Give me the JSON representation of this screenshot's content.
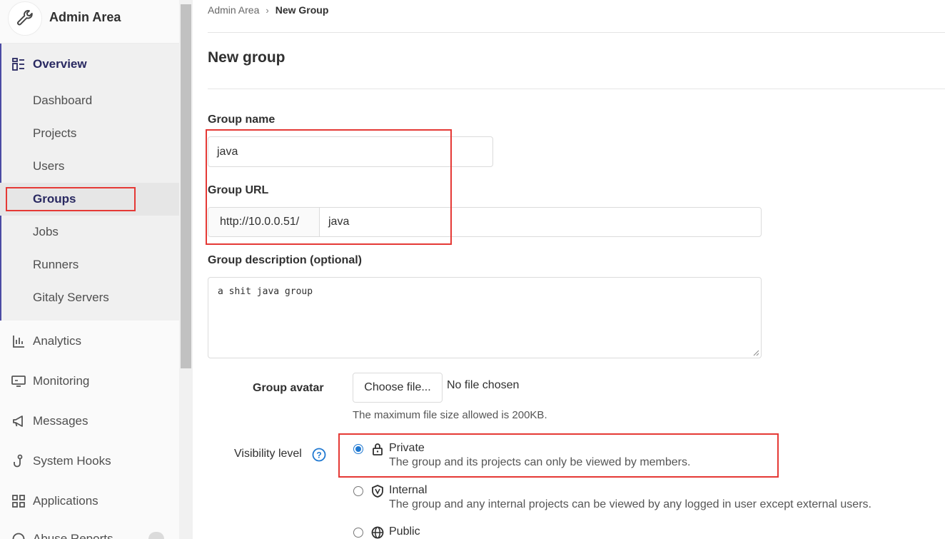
{
  "sidebar": {
    "title": "Admin Area",
    "overview": "Overview",
    "sub_items": [
      {
        "label": "Dashboard"
      },
      {
        "label": "Projects"
      },
      {
        "label": "Users"
      },
      {
        "label": "Groups"
      },
      {
        "label": "Jobs"
      },
      {
        "label": "Runners"
      },
      {
        "label": "Gitaly Servers"
      }
    ],
    "main_items": [
      {
        "label": "Analytics",
        "icon": "analytics-icon"
      },
      {
        "label": "Monitoring",
        "icon": "monitor-icon"
      },
      {
        "label": "Messages",
        "icon": "megaphone-icon"
      },
      {
        "label": "System Hooks",
        "icon": "hook-icon"
      },
      {
        "label": "Applications",
        "icon": "applications-icon"
      },
      {
        "label": "Abuse Reports",
        "icon": "abuse-icon"
      }
    ]
  },
  "breadcrumb": {
    "parent": "Admin Area",
    "current": "New Group"
  },
  "page": {
    "title": "New group"
  },
  "form": {
    "group_name_label": "Group name",
    "group_name_value": "java",
    "group_url_label": "Group URL",
    "url_prefix": "http://10.0.0.51/",
    "url_value": "java",
    "description_label": "Group description (optional)",
    "description_value": "a shit java group",
    "avatar_label": "Group avatar",
    "choose_file": "Choose file...",
    "no_file": "No file chosen",
    "max_size_help": "The maximum file size allowed is 200KB.",
    "visibility_label": "Visibility level",
    "visibility_options": [
      {
        "title": "Private",
        "desc": "The group and its projects can only be viewed by members.",
        "checked": true,
        "icon": "lock-icon"
      },
      {
        "title": "Internal",
        "desc": "The group and any internal projects can be viewed by any logged in user except external users.",
        "checked": false,
        "icon": "shield-icon"
      },
      {
        "title": "Public",
        "desc": "",
        "checked": false,
        "icon": "globe-icon"
      }
    ]
  },
  "colors": {
    "accent": "#292961",
    "highlight_box": "#e53935",
    "radio_checked": "#1f78d1"
  }
}
